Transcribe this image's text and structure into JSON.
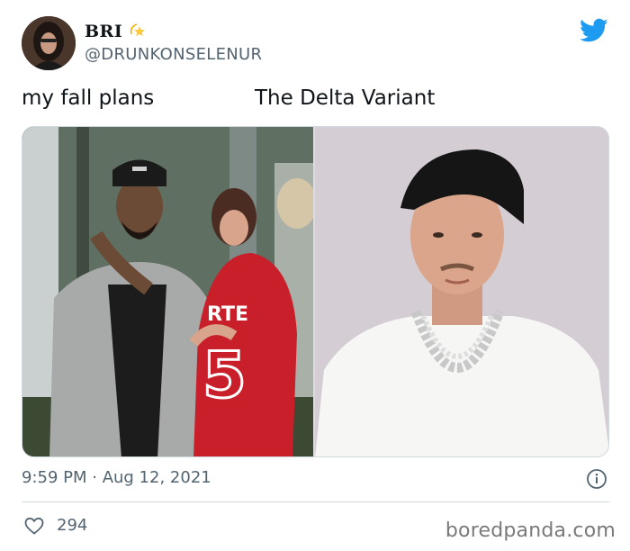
{
  "tweet": {
    "author": {
      "display_name": "BRI",
      "badge_emoji": "💫",
      "handle": "@DRUNKONSELENUR",
      "avatar_icon": "profile-photo"
    },
    "text_left": "my fall plans",
    "text_right": "The Delta Variant",
    "timestamp": "9:59 PM · Aug 12, 2021",
    "likes": "294",
    "brand_color": "#1d9bf0",
    "icons": {
      "brand": "twitter-bird-icon",
      "info": "info-icon",
      "like": "heart-icon"
    }
  },
  "watermark": "boredpanda.com"
}
